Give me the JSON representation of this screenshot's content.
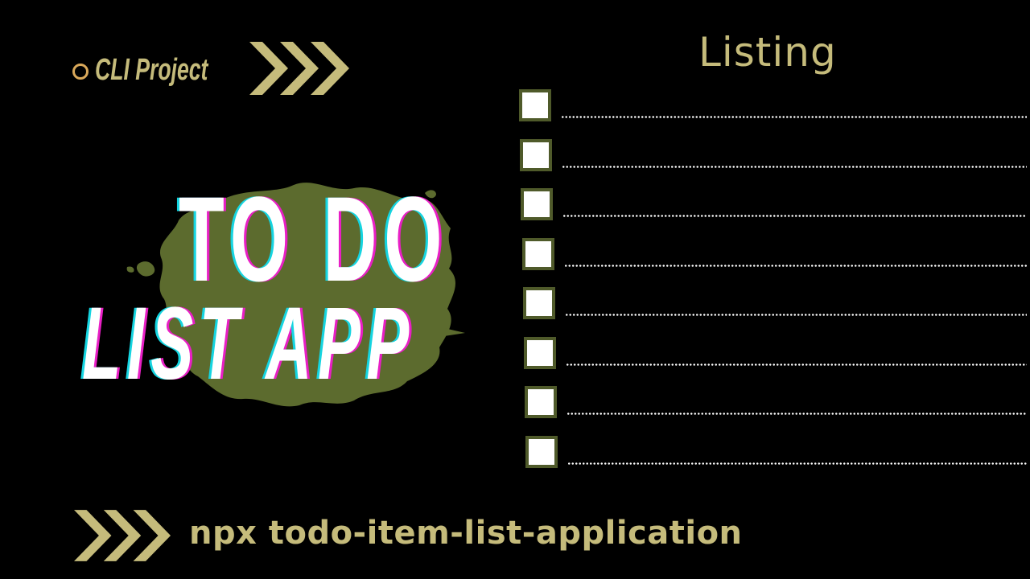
{
  "badge": {
    "label": "CLI Project",
    "ring_icon": "ring-icon",
    "arrows_icon": "triple-chevron-right-icon"
  },
  "title": {
    "line1": "TO DO",
    "line2": "LIST APP",
    "splatter": "paint-splatter"
  },
  "listing": {
    "heading": "Listing",
    "items": [
      {
        "checked": false
      },
      {
        "checked": false
      },
      {
        "checked": false
      },
      {
        "checked": false
      },
      {
        "checked": false
      },
      {
        "checked": false
      },
      {
        "checked": false
      },
      {
        "checked": false
      }
    ]
  },
  "command": {
    "arrows_icon": "triple-chevron-right-icon",
    "text": "npx todo-item-list-application"
  },
  "colors": {
    "background": "#000000",
    "accent": "#c5bb7b",
    "splatter": "#5c6b2e",
    "checkbox_border": "#4f5a2a",
    "glitch_cyan": "#15d4e0",
    "glitch_magenta": "#e81fc5"
  }
}
